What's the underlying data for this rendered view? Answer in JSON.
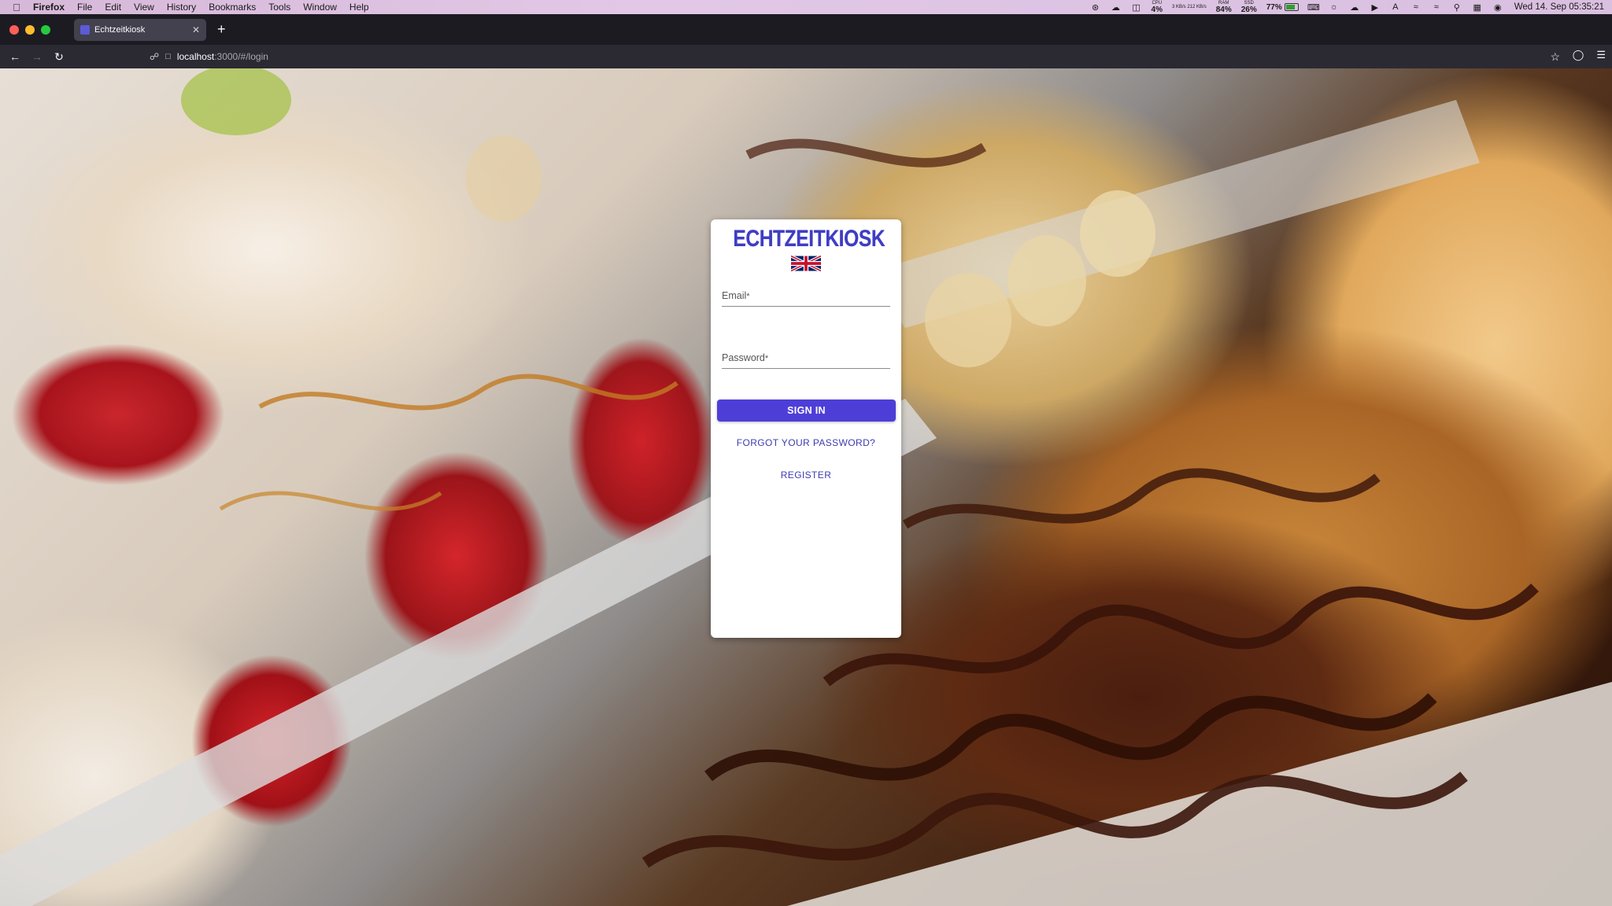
{
  "menubar": {
    "app": "Firefox",
    "items": [
      "File",
      "Edit",
      "View",
      "History",
      "Bookmarks",
      "Tools",
      "Window",
      "Help"
    ],
    "stats": [
      {
        "key": "CPU",
        "value": "4%"
      },
      {
        "key": "3 KB/s 212 KB/s",
        "value": ""
      },
      {
        "key": "RAM",
        "value": "84%"
      },
      {
        "key": "SSD",
        "value": "26%"
      }
    ],
    "battery": "77%",
    "clock": "Wed 14. Sep  05:35:21"
  },
  "browser": {
    "tab_title": "Echtzeitkiosk",
    "url_host": "localhost",
    "url_path": ":3000/#/login"
  },
  "login": {
    "brand": "ECHTZEITKIOSK",
    "language_flag": "uk-flag-icon",
    "email_label": "Email",
    "password_label": "Password",
    "required_mark": "*",
    "signin_label": "SIGN IN",
    "forgot_label": "FORGOT YOUR PASSWORD?",
    "register_label": "REGISTER",
    "accent_color": "#4e3ed8"
  }
}
